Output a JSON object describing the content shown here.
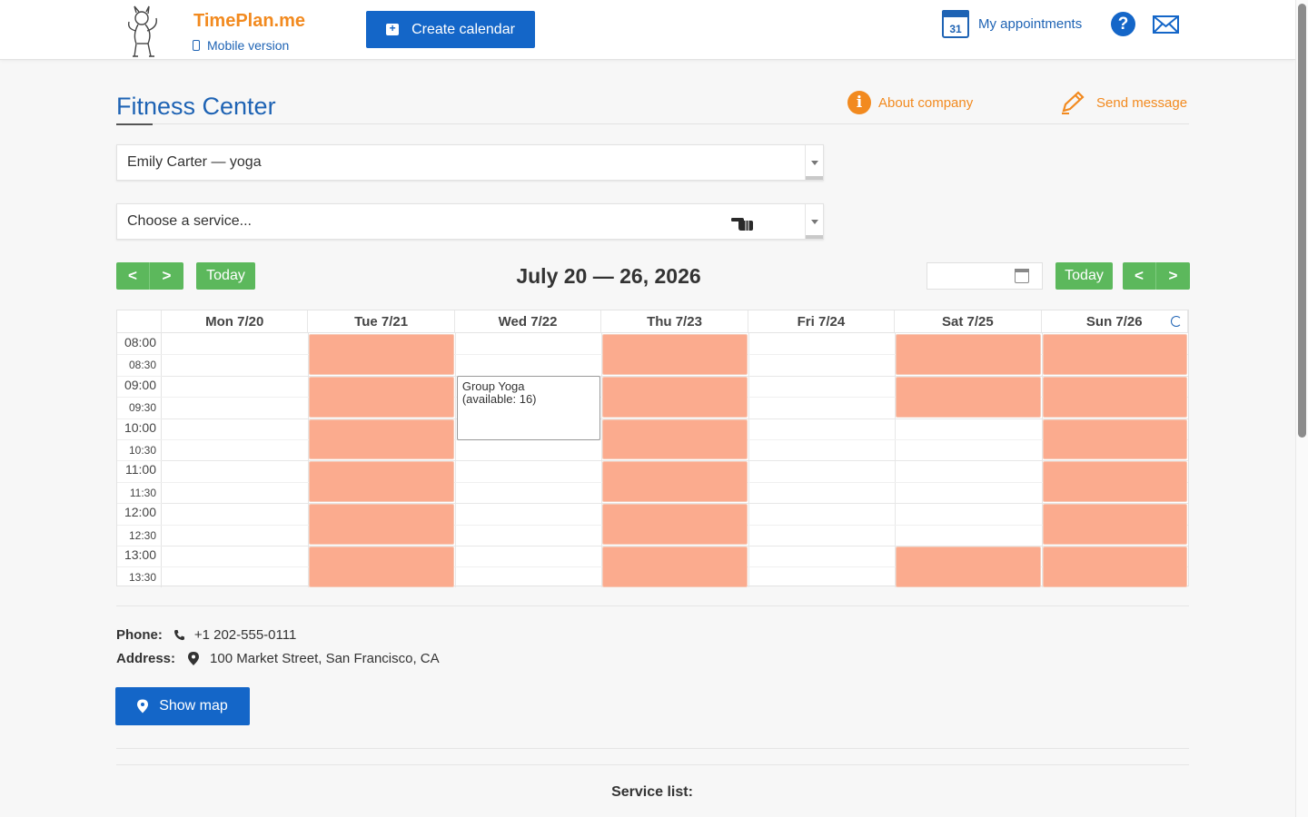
{
  "header": {
    "brand": "TimePlan.me",
    "mobile_link": "Mobile version",
    "create_button": "Create calendar",
    "appointments_label": "My appointments",
    "calendar_day": "31",
    "help_symbol": "?",
    "icons": [
      "logo-mascot-icon",
      "mobile-phone-icon",
      "calendar-plus-icon",
      "calendar-icon",
      "help-icon",
      "mail-icon"
    ]
  },
  "company": {
    "title": "Fitness Center",
    "about_label": "About company",
    "info_symbol": "i",
    "send_label": "Send message"
  },
  "filters": {
    "staff_value": "Emily Carter — yoga",
    "service_placeholder": "Choose a service..."
  },
  "toolbar": {
    "prev_symbol": "<",
    "next_symbol": ">",
    "today_label": "Today",
    "week_title": "July 20 — 26, 2026",
    "date_input_value": ""
  },
  "calendar": {
    "days": [
      "Mon 7/20",
      "Tue 7/21",
      "Wed 7/22",
      "Thu 7/23",
      "Fri 7/24",
      "Sat 7/25",
      "Sun 7/26"
    ],
    "times": [
      {
        "label": "08:00",
        "hour": true
      },
      {
        "label": "08:30",
        "hour": false
      },
      {
        "label": "09:00",
        "hour": true
      },
      {
        "label": "09:30",
        "hour": false
      },
      {
        "label": "10:00",
        "hour": true
      },
      {
        "label": "10:30",
        "hour": false
      },
      {
        "label": "11:00",
        "hour": true
      },
      {
        "label": "11:30",
        "hour": false
      },
      {
        "label": "12:00",
        "hour": true
      },
      {
        "label": "12:30",
        "hour": false
      },
      {
        "label": "13:00",
        "hour": true
      },
      {
        "label": "13:30",
        "hour": false
      }
    ],
    "busy_blocks": [
      {
        "day": "Tue 7/21",
        "start": "08:00",
        "end": "09:00"
      },
      {
        "day": "Tue 7/21",
        "start": "09:00",
        "end": "10:00"
      },
      {
        "day": "Tue 7/21",
        "start": "10:00",
        "end": "11:00"
      },
      {
        "day": "Tue 7/21",
        "start": "11:00",
        "end": "12:00"
      },
      {
        "day": "Tue 7/21",
        "start": "12:00",
        "end": "13:00"
      },
      {
        "day": "Tue 7/21",
        "start": "13:00",
        "end": "14:00"
      },
      {
        "day": "Thu 7/23",
        "start": "08:00",
        "end": "09:00"
      },
      {
        "day": "Thu 7/23",
        "start": "09:00",
        "end": "10:00"
      },
      {
        "day": "Thu 7/23",
        "start": "10:00",
        "end": "11:00"
      },
      {
        "day": "Thu 7/23",
        "start": "11:00",
        "end": "12:00"
      },
      {
        "day": "Thu 7/23",
        "start": "12:00",
        "end": "13:00"
      },
      {
        "day": "Thu 7/23",
        "start": "13:00",
        "end": "14:00"
      },
      {
        "day": "Sat 7/25",
        "start": "08:00",
        "end": "09:00"
      },
      {
        "day": "Sat 7/25",
        "start": "09:00",
        "end": "10:00"
      },
      {
        "day": "Sat 7/25",
        "start": "13:00",
        "end": "14:00"
      },
      {
        "day": "Sun 7/26",
        "start": "08:00",
        "end": "09:00"
      },
      {
        "day": "Sun 7/26",
        "start": "09:00",
        "end": "10:00"
      },
      {
        "day": "Sun 7/26",
        "start": "10:00",
        "end": "11:00"
      },
      {
        "day": "Sun 7/26",
        "start": "11:00",
        "end": "12:00"
      },
      {
        "day": "Sun 7/26",
        "start": "12:00",
        "end": "13:00"
      },
      {
        "day": "Sun 7/26",
        "start": "13:00",
        "end": "14:00"
      }
    ],
    "events": [
      {
        "day": "Wed 7/22",
        "start": "09:00",
        "end": "10:30",
        "title": "Group Yoga",
        "detail": "(available: 16)"
      }
    ],
    "busy_color": "#fbab8e"
  },
  "contact": {
    "phone_label": "Phone:",
    "phone_value": "+1 202-555-0111",
    "address_label": "Address:",
    "address_value": "100 Market Street, San Francisco, CA",
    "map_button": "Show map"
  },
  "services": {
    "heading": "Service list:"
  },
  "colors": {
    "brand_orange": "#f28a1f",
    "primary_blue": "#1466c8",
    "nav_green": "#5cb85c"
  }
}
